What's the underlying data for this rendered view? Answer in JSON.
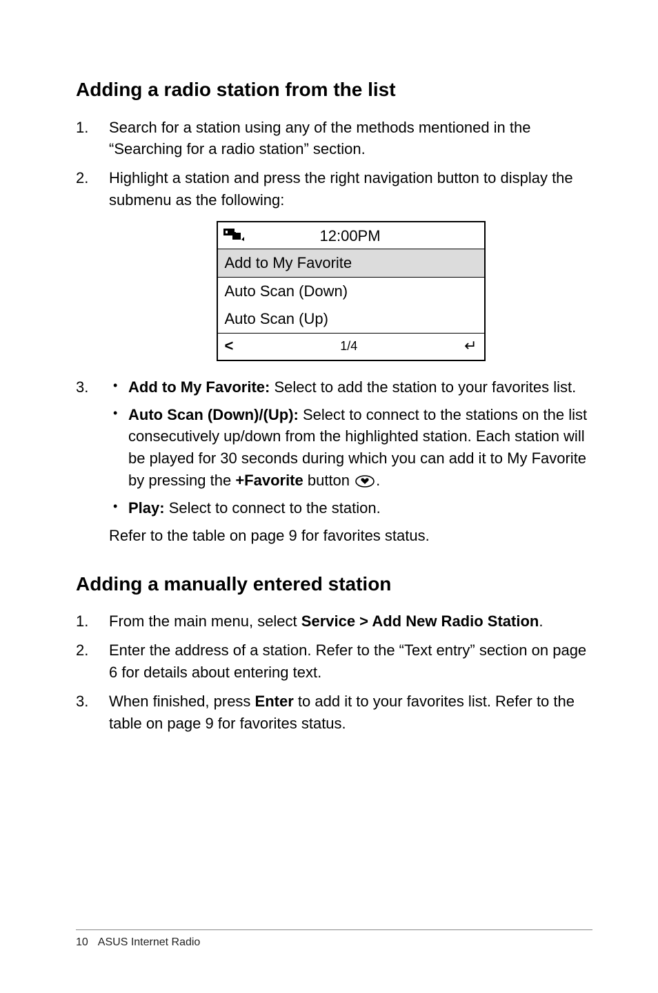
{
  "section1": {
    "heading": "Adding a radio station from the list",
    "step1": "Search for a station using any of the methods mentioned in the “Searching for a radio station” section.",
    "step2": "Highlight a station and press the right navigation button to display the submenu as the following:",
    "submenu": {
      "time": "12:00PM",
      "row1": "Add to My Favorite",
      "row2": "Auto Scan (Down)",
      "row3": "Auto Scan (Up)",
      "footer_left": "<",
      "footer_mid": "1/4",
      "footer_right": "↵"
    },
    "step3": {
      "b1_label": "Add to My Favorite:",
      "b1_text": " Select to add the station to your favorites list.",
      "b2_label": "Auto Scan (Down)/(Up):",
      "b2_text_a": " Select to connect to the stations on the list consecutively up/down from the highlighted station. Each station will be played for 30 seconds during which you can add it to My Favorite by pressing the ",
      "b2_bold_fav": "+Favorite",
      "b2_text_b": " button ",
      "b2_text_c": ".",
      "b3_label": "Play:",
      "b3_text": " Select to connect to the station.",
      "after": "Refer to the table on page 9 for favorites status."
    }
  },
  "section2": {
    "heading": "Adding a manually entered station",
    "step1_a": "From the main menu, select ",
    "step1_bold": "Service > Add New Radio Station",
    "step1_b": ".",
    "step2": "Enter the address of a station. Refer to the “Text entry” section on page 6 for details about entering text.",
    "step3_a": "When finished, press ",
    "step3_bold": "Enter",
    "step3_b": " to add it to your favorites list. Refer to the table on page 9 for favorites status."
  },
  "footer": {
    "page": "10",
    "title": "ASUS Internet Radio"
  }
}
